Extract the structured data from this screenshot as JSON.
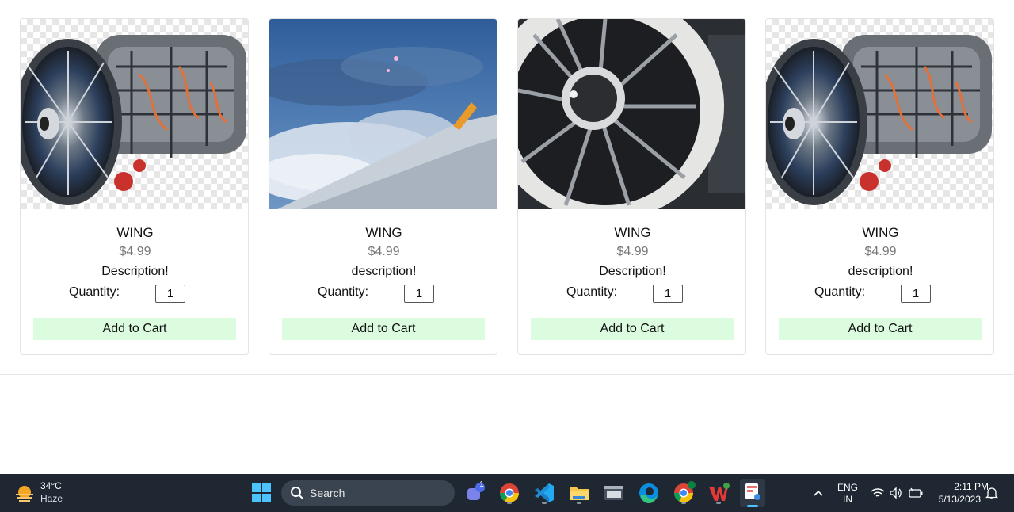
{
  "products": [
    {
      "name": "WING",
      "price": "$4.99",
      "description": "Description!",
      "quantity_label": "Quantity:",
      "quantity": "1",
      "button": "Add to Cart",
      "image": "jet-engine-cutaway"
    },
    {
      "name": "WING",
      "price": "$4.99",
      "description": "description!",
      "quantity_label": "Quantity:",
      "quantity": "1",
      "button": "Add to Cart",
      "image": "airplane-wing-clouds"
    },
    {
      "name": "WING",
      "price": "$4.99",
      "description": "Description!",
      "quantity_label": "Quantity:",
      "quantity": "1",
      "button": "Add to Cart",
      "image": "turbofan-front"
    },
    {
      "name": "WING",
      "price": "$4.99",
      "description": "description!",
      "quantity_label": "Quantity:",
      "quantity": "1",
      "button": "Add to Cart",
      "image": "jet-engine-cutaway"
    }
  ],
  "colors": {
    "button_bg": "#dcfce0",
    "taskbar_bg": "#1f2733",
    "accent": "#4cc2ff"
  },
  "taskbar": {
    "weather": {
      "temp": "34°C",
      "condition": "Haze",
      "icon": "haze-sun-icon"
    },
    "search_label": "Search",
    "apps": [
      "windows-start-icon",
      "teams-icon",
      "chrome-icon",
      "vscode-icon",
      "file-explorer-icon",
      "terminal-icon",
      "edge-icon",
      "chrome-profile-icon",
      "wps-office-icon",
      "snipping-tool-icon"
    ],
    "teams_badge": "1",
    "tray": {
      "lang_top": "ENG",
      "lang_bottom": "IN",
      "time": "2:11 PM",
      "date": "5/13/2023"
    }
  }
}
